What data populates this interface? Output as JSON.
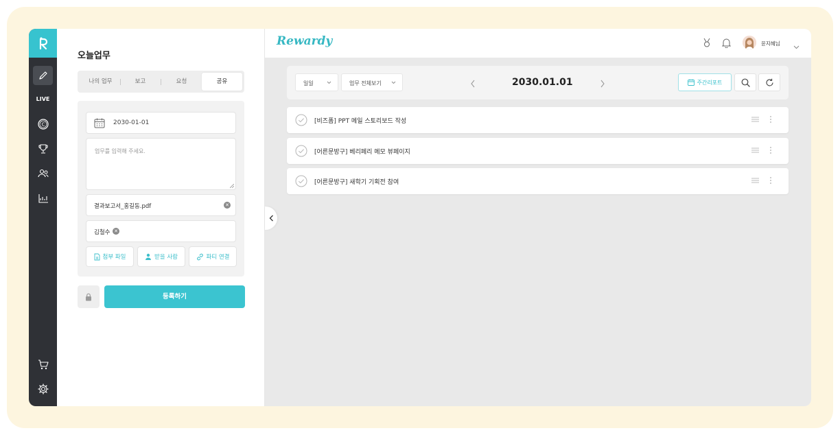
{
  "brand": "Rewardy",
  "rail": {
    "live_label": "LIVE",
    "icons": [
      "logo-icon",
      "pencil-icon",
      "coin-icon",
      "trophy-icon",
      "users-icon",
      "chart-icon",
      "cart-icon",
      "settings-icon"
    ]
  },
  "panel": {
    "title": "오늘업무",
    "tabs": [
      {
        "label": "나의 업무",
        "active": false
      },
      {
        "label": "보고",
        "active": false
      },
      {
        "label": "요청",
        "active": false
      },
      {
        "label": "공유",
        "active": true
      }
    ],
    "date_value": "2030-01-01",
    "task_placeholder": "업무를 입력해 주세요.",
    "attached_file": "결과보고서_홍길동.pdf",
    "recipient": "김철수",
    "buttons": {
      "attach": "첨부 파일",
      "recipient": "받을 사람",
      "party": "파티 연결"
    },
    "submit": "등록하기"
  },
  "header": {
    "user_name": "윤지혜님"
  },
  "toolbar": {
    "period_select": "일일",
    "view_select": "업무 전체보기",
    "current_date": "2030.01.01",
    "weekly_report": "주간리포트"
  },
  "tasks": [
    {
      "title": "[비즈폼] PPT 메일 스토리보드 작성"
    },
    {
      "title": "[어른문방구] 베리페리 메모 뷰페이지"
    },
    {
      "title": "[어른문방구] 새학기 기획전 참여"
    }
  ],
  "colors": {
    "accent": "#3bc4d0",
    "rail": "#2f3136",
    "frame": "#fdf5df"
  }
}
